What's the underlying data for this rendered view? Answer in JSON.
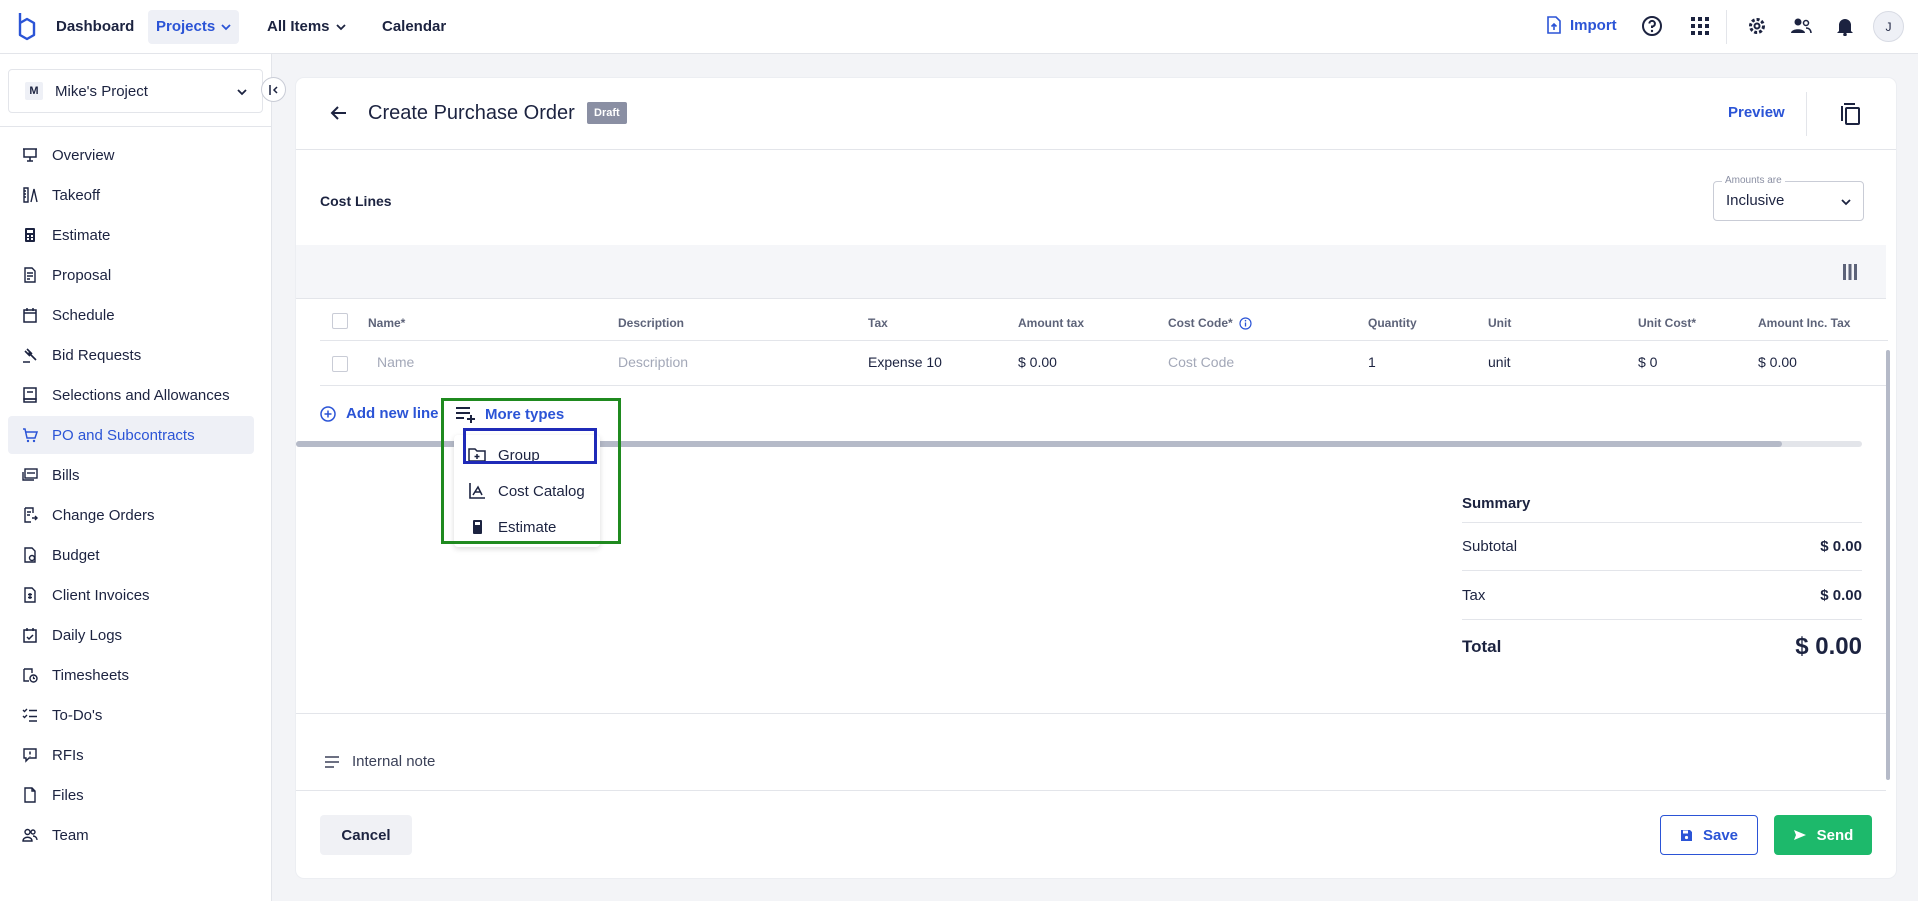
{
  "topbar": {
    "nav": [
      {
        "label": "Dashboard"
      },
      {
        "label": "Projects"
      },
      {
        "label": "All Items"
      },
      {
        "label": "Calendar"
      }
    ],
    "import_label": "Import",
    "avatar_initial": "J"
  },
  "sidebar": {
    "project": {
      "badge": "M",
      "name": "Mike's Project"
    },
    "items": [
      {
        "label": "Overview"
      },
      {
        "label": "Takeoff"
      },
      {
        "label": "Estimate"
      },
      {
        "label": "Proposal"
      },
      {
        "label": "Schedule"
      },
      {
        "label": "Bid Requests"
      },
      {
        "label": "Selections and Allowances"
      },
      {
        "label": "PO and Subcontracts"
      },
      {
        "label": "Bills"
      },
      {
        "label": "Change Orders"
      },
      {
        "label": "Budget"
      },
      {
        "label": "Client Invoices"
      },
      {
        "label": "Daily Logs"
      },
      {
        "label": "Timesheets"
      },
      {
        "label": "To-Do's"
      },
      {
        "label": "RFIs"
      },
      {
        "label": "Files"
      },
      {
        "label": "Team"
      }
    ]
  },
  "header": {
    "title": "Create Purchase Order",
    "status": "Draft",
    "preview_label": "Preview"
  },
  "cost_lines": {
    "title": "Cost Lines",
    "amounts": {
      "label": "Amounts are",
      "value": "Inclusive"
    },
    "columns": [
      "Name*",
      "Description",
      "Tax",
      "Amount tax",
      "Cost Code*",
      "Quantity",
      "Unit",
      "Unit Cost*",
      "Amount Inc. Tax"
    ],
    "row": {
      "name_placeholder": "Name",
      "description_placeholder": "Description",
      "tax": "Expense 10",
      "amount_tax": "$ 0.00",
      "cost_code_placeholder": "Cost Code",
      "quantity": "1",
      "unit": "unit",
      "unit_cost": "$ 0",
      "amount_inc_tax": "$ 0.00"
    },
    "add_line_label": "Add new line",
    "more_types_label": "More types",
    "more_types_menu": [
      {
        "label": "Group"
      },
      {
        "label": "Cost Catalog"
      },
      {
        "label": "Estimate"
      }
    ]
  },
  "summary": {
    "title": "Summary",
    "subtotal_label": "Subtotal",
    "subtotal_value": "$ 0.00",
    "tax_label": "Tax",
    "tax_value": "$ 0.00",
    "total_label": "Total",
    "total_value": "$ 0.00"
  },
  "internal_note_label": "Internal note",
  "footer": {
    "cancel_label": "Cancel",
    "save_label": "Save",
    "send_label": "Send"
  },
  "colors": {
    "accent": "#2b54d6",
    "send": "#1db96b",
    "highlight_outer": "#1f8a1f",
    "highlight_inner": "#1f2ab8"
  }
}
